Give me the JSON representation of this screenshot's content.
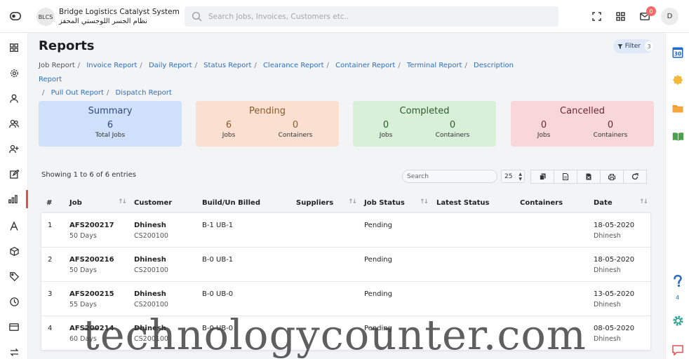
{
  "app": {
    "logo_text": "BLCS",
    "name_en": "Bridge Logistics Catalyst System",
    "name_ar": "نظام الجسر اللوجستي المحفز"
  },
  "search": {
    "placeholder": "Search Jobs, Invoices, Customers etc.."
  },
  "header": {
    "notification_count": "0",
    "avatar_initial": "D"
  },
  "page": {
    "title": "Reports",
    "filter_label": "Filter",
    "filter_count": "3"
  },
  "breadcrumbs": [
    {
      "label": "Job Report",
      "link": false
    },
    {
      "label": "Invoice Report",
      "link": true
    },
    {
      "label": "Daily Report",
      "link": true
    },
    {
      "label": "Status Report",
      "link": true
    },
    {
      "label": "Clearance Report",
      "link": true
    },
    {
      "label": "Container Report",
      "link": true
    },
    {
      "label": "Terminal Report",
      "link": true
    },
    {
      "label": "Description Report",
      "link": true
    },
    {
      "label": "Pull Out Report",
      "link": true
    },
    {
      "label": "Dispatch Report",
      "link": true
    }
  ],
  "cards": {
    "summary": {
      "title": "Summary",
      "value": "6",
      "label": "Total Jobs",
      "bg": "#cfe0fb",
      "color": "#2f4a7a"
    },
    "pending": {
      "title": "Pending",
      "jobs": "6",
      "jobs_label": "Jobs",
      "containers": "0",
      "containers_label": "Containers",
      "bg": "#fbe0d2",
      "color": "#8a5a2a"
    },
    "completed": {
      "title": "Completed",
      "jobs": "0",
      "jobs_label": "Jobs",
      "containers": "0",
      "containers_label": "Containers",
      "bg": "#d8efd8",
      "color": "#2f5a2f"
    },
    "cancelled": {
      "title": "Cancelled",
      "jobs": "0",
      "jobs_label": "Jobs",
      "containers": "0",
      "containers_label": "Containers",
      "bg": "#f8d6da",
      "color": "#6a2a30"
    }
  },
  "table_controls": {
    "showing": "Showing 1 to 6 of 6 entries",
    "search_placeholder": "Search",
    "page_size": "25"
  },
  "table": {
    "headers": {
      "num": "#",
      "job": "Job",
      "customer": "Customer",
      "build": "Build/Un Billed",
      "suppliers": "Suppliers",
      "job_status": "Job Status",
      "latest_status": "Latest Status",
      "containers": "Containers",
      "date": "Date"
    },
    "rows": [
      {
        "num": "1",
        "job": "AFS200217",
        "days": "50 Days",
        "customer": "Dhinesh",
        "customer_code": "CS200100",
        "build": "B-1 UB-1",
        "status": "Pending",
        "date": "18-05-2020",
        "date_by": "Dhinesh"
      },
      {
        "num": "2",
        "job": "AFS200216",
        "days": "50 Days",
        "customer": "Dhinesh",
        "customer_code": "CS200100",
        "build": "B-0 UB-1",
        "status": "Pending",
        "date": "18-05-2020",
        "date_by": "Dhinesh"
      },
      {
        "num": "3",
        "job": "AFS200215",
        "days": "55 Days",
        "customer": "Dhinesh",
        "customer_code": "CS200100",
        "build": "B-0 UB-0",
        "status": "Pending",
        "date": "13-05-2020",
        "date_by": "Dhinesh"
      },
      {
        "num": "4",
        "job": "AFS200214",
        "days": "60 Days",
        "customer": "Dhinesh",
        "customer_code": "CS200100",
        "build": "B-0 UB-0",
        "status": "Pending",
        "date": "08-05-2020",
        "date_by": "Dhinesh"
      }
    ]
  },
  "right_rail": {
    "calendar_day": "30",
    "help_count": "4"
  },
  "watermark": "technologycounter.com"
}
